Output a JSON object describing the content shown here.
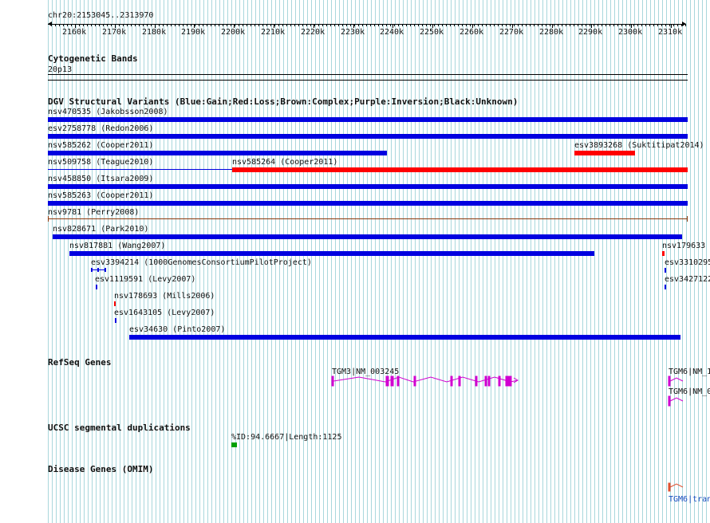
{
  "position": "chr20:2153045..2313970",
  "ruler": {
    "labels": [
      "2160k",
      "2170k",
      "2180k",
      "2190k",
      "2200k",
      "2210k",
      "2220k",
      "2230k",
      "2240k",
      "2250k",
      "2260k",
      "2270k",
      "2280k",
      "2290k",
      "2300k",
      "2310k"
    ]
  },
  "cyto": {
    "title": "Cytogenetic Bands",
    "band": "20p13"
  },
  "dgv": {
    "title": "DGV Structural Variants (Blue:Gain;Red:Loss;Brown:Complex;Purple:Inversion;Black:Unknown)",
    "features": [
      {
        "label": "nsv470535 (Jakobsson2008)",
        "color": "#0000e0"
      },
      {
        "label": "esv2758778 (Redon2006)",
        "color": "#0000e0"
      },
      {
        "label": "nsv585262 (Cooper2011)",
        "color": "#0000e0"
      },
      {
        "label": "esv3893268 (Suktitipat2014)",
        "color": "#ff0000"
      },
      {
        "label": "nsv509758 (Teague2010)",
        "color": "#0000e0"
      },
      {
        "label": "nsv585264 (Cooper2011)",
        "color": "#ff0000"
      },
      {
        "label": "nsv458850 (Itsara2009)",
        "color": "#0000e0"
      },
      {
        "label": "nsv585263 (Cooper2011)",
        "color": "#0000e0"
      },
      {
        "label": "nsv9781 (Perry2008)",
        "color": "#8b3a0f"
      },
      {
        "label": "nsv828671 (Park2010)",
        "color": "#0000e0"
      },
      {
        "label": "nsv817881 (Wang2007)",
        "color": "#0000e0"
      },
      {
        "label": "nsv179633",
        "color": "#ff0000"
      },
      {
        "label": "esv3394214 (1000GenomesConsortiumPilotProject)",
        "color": "#0000e0"
      },
      {
        "label": "esv3310295",
        "color": "#0000e0"
      },
      {
        "label": "esv1119591 (Levy2007)",
        "color": "#0000e0"
      },
      {
        "label": "esv3427122",
        "color": "#0000e0"
      },
      {
        "label": "nsv178693 (Mills2006)",
        "color": "#ff0000"
      },
      {
        "label": "esv1643105 (Levy2007)",
        "color": "#0000e0"
      },
      {
        "label": "esv34630 (Pinto2007)",
        "color": "#0000e0"
      }
    ]
  },
  "refseq": {
    "title": "RefSeq Genes",
    "genes": [
      {
        "label": "TGM3|NM_003245"
      },
      {
        "label": "TGM6|NM_1"
      },
      {
        "label": "TGM6|NM_0"
      }
    ],
    "color": "#d000d0"
  },
  "segdup": {
    "title": "UCSC segmental duplications",
    "label": "%ID:94.6667|Length:1125",
    "color": "#00a000"
  },
  "omim": {
    "title": "Disease Genes (OMIM)",
    "label": "TGM6|tran",
    "color": "#e05030"
  }
}
